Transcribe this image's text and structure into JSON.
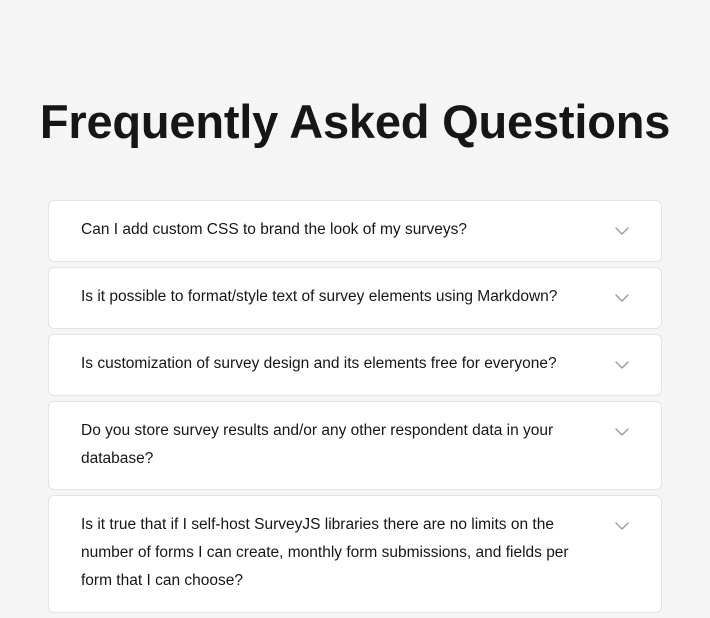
{
  "page": {
    "title": "Frequently Asked Questions"
  },
  "faq": {
    "items": [
      {
        "question": "Can I add custom CSS to brand the look of my surveys?"
      },
      {
        "question": "Is it possible to format/style text of survey elements using Markdown?"
      },
      {
        "question": "Is customization of survey design and its elements free for everyone?"
      },
      {
        "question": "Do you store survey results and/or any other respondent data in your database?"
      },
      {
        "question": "Is it true that if I self-host SurveyJS libraries there are no limits on the number of forms I can create, monthly form submissions, and fields per form that I can choose?"
      }
    ]
  },
  "icons": {
    "expand": "chevron-down-icon"
  },
  "colors": {
    "background": "#f5f5f5",
    "card": "#ffffff",
    "border": "#e4e4e4",
    "text": "#161616",
    "icon": "#9a9a9a"
  }
}
